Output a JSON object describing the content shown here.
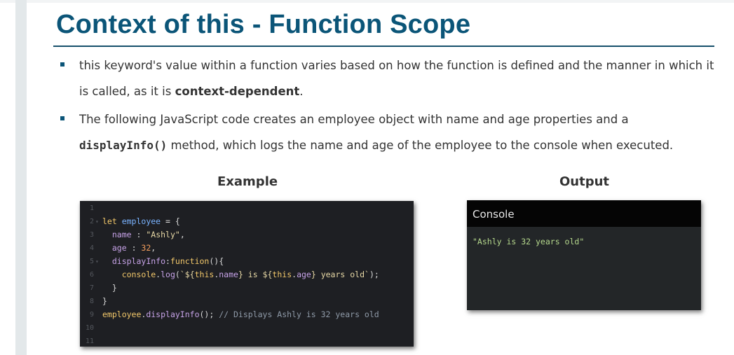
{
  "slide": {
    "title": "Context of this - Function Scope",
    "bullets": [
      {
        "text_before": "this keyword's value within a function varies based on how the function is defined and the manner in which it is called, as it is ",
        "bold": "context-dependent",
        "text_after": "."
      },
      {
        "text_before": "The following JavaScript code creates an employee object with name and age properties and a ",
        "code": "displayInfo()",
        "text_after": " method, which logs the name and age of the employee to the console when executed."
      }
    ]
  },
  "example": {
    "label": "Example",
    "code_lines": [
      {
        "n": "1",
        "fold": "",
        "tokens": []
      },
      {
        "n": "2",
        "fold": "▾",
        "tokens": [
          [
            "kw",
            "let "
          ],
          [
            "var",
            "employee"
          ],
          [
            "plain",
            " = {"
          ]
        ]
      },
      {
        "n": "3",
        "fold": "",
        "tokens": [
          [
            "plain",
            "  "
          ],
          [
            "prop",
            "name"
          ],
          [
            "plain",
            " : "
          ],
          [
            "str",
            "\"Ashly\""
          ],
          [
            "plain",
            ","
          ]
        ]
      },
      {
        "n": "4",
        "fold": "",
        "tokens": [
          [
            "plain",
            "  "
          ],
          [
            "prop",
            "age"
          ],
          [
            "plain",
            " : "
          ],
          [
            "num",
            "32"
          ],
          [
            "plain",
            ","
          ]
        ]
      },
      {
        "n": "5",
        "fold": "▾",
        "tokens": [
          [
            "plain",
            "  "
          ],
          [
            "prop",
            "displayInfo"
          ],
          [
            "plain",
            ":"
          ],
          [
            "kw",
            "function"
          ],
          [
            "plain",
            "(){"
          ]
        ]
      },
      {
        "n": "6",
        "fold": "",
        "tokens": [
          [
            "plain",
            "    "
          ],
          [
            "kw",
            "console"
          ],
          [
            "plain",
            "."
          ],
          [
            "prop",
            "log"
          ],
          [
            "plain",
            "("
          ],
          [
            "str",
            "`${"
          ],
          [
            "kw",
            "this"
          ],
          [
            "plain",
            "."
          ],
          [
            "prop",
            "name"
          ],
          [
            "str",
            "} is ${"
          ],
          [
            "kw",
            "this"
          ],
          [
            "plain",
            "."
          ],
          [
            "prop",
            "age"
          ],
          [
            "str",
            "} years old`"
          ],
          [
            "plain",
            ");"
          ]
        ]
      },
      {
        "n": "7",
        "fold": "",
        "tokens": [
          [
            "plain",
            "  }"
          ]
        ]
      },
      {
        "n": "8",
        "fold": "",
        "tokens": [
          [
            "plain",
            "}"
          ]
        ]
      },
      {
        "n": "9",
        "fold": "",
        "tokens": [
          [
            "kw",
            "employee"
          ],
          [
            "plain",
            "."
          ],
          [
            "prop",
            "displayInfo"
          ],
          [
            "plain",
            "(); "
          ],
          [
            "cmt",
            "// Displays Ashly is 32 years old"
          ]
        ]
      },
      {
        "n": "10",
        "fold": "",
        "tokens": []
      },
      {
        "n": "11",
        "fold": "",
        "tokens": []
      }
    ]
  },
  "output": {
    "label": "Output",
    "console_title": "Console",
    "console_text": "\"Ashly is 32 years old\""
  },
  "colors": {
    "title": "#0b5578",
    "code_background": "#1e1f23",
    "console_header": "#050505",
    "console_output": "#b6d98d"
  }
}
